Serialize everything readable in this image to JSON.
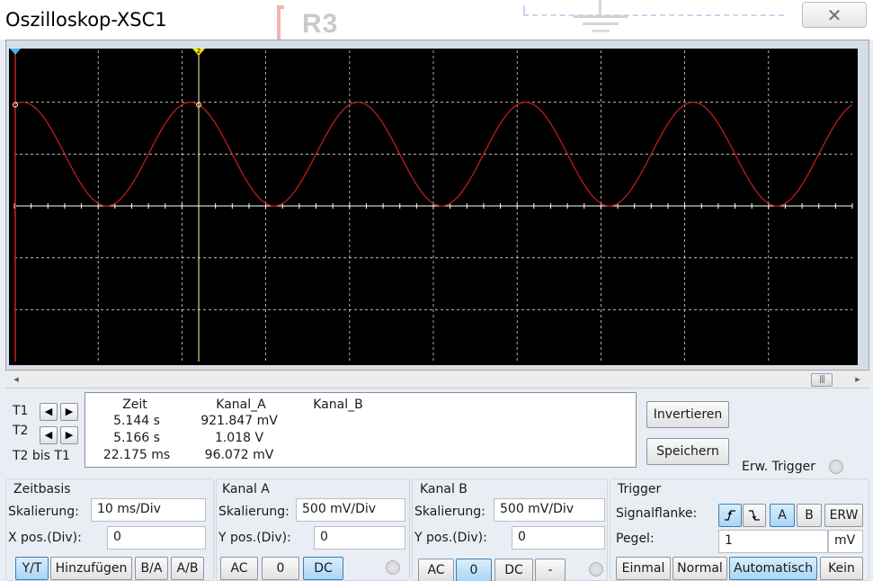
{
  "window": {
    "title": "Oszilloskop-XSC1",
    "close_icon": "close-icon"
  },
  "backdrop": {
    "component_label": "R3"
  },
  "scope": {
    "background": "#000000",
    "grid_color": "#ffffff",
    "trace_color": "#cc1f1f",
    "cursor_color": "#fff6a0",
    "divisions_x": 10,
    "divisions_y": 6,
    "cursor_marker_t2": "2",
    "t1_marker_icon": "cursor-t1-marker-icon",
    "t2_marker_icon": "cursor-t2-marker-icon"
  },
  "chart_data": {
    "type": "line",
    "series": [
      {
        "name": "Kanal_A",
        "color": "#cc1f1f",
        "waveform": "sine",
        "amplitude_div": 1.0,
        "offset_div": 1.0,
        "period_div": 2.0
      }
    ],
    "xlim_div": [
      0,
      10
    ],
    "ylim_div": [
      -3,
      3
    ]
  },
  "scrollbar": {
    "left_arrow": "◂",
    "right_arrow": "▸",
    "thumb_grip": "|||"
  },
  "cursors": {
    "t1_label": "T1",
    "t2_label": "T2",
    "diff_label": "T2 bis T1",
    "left_arrow": "◀",
    "right_arrow": "▶",
    "headers": {
      "time": "Zeit",
      "channel_a": "Kanal_A",
      "channel_b": "Kanal_B"
    },
    "rows": [
      {
        "time": "5.144 s",
        "channel_a": "921.847 mV",
        "channel_b": ""
      },
      {
        "time": "5.166 s",
        "channel_a": "1.018 V",
        "channel_b": ""
      },
      {
        "time": "22.175 ms",
        "channel_a": "96.072 mV",
        "channel_b": ""
      }
    ]
  },
  "side_buttons": {
    "invert": "Invertieren",
    "save": "Speichern",
    "ext_trigger": "Erw. Trigger"
  },
  "timebase": {
    "title": "Zeitbasis",
    "scale_label": "Skalierung:",
    "scale_value": "10 ms/Div",
    "xpos_label": "X pos.(Div):",
    "xpos_value": "0",
    "modes": [
      "Y/T",
      "Hinzufügen",
      "B/A",
      "A/B"
    ],
    "active_mode": "Y/T"
  },
  "channel_a": {
    "title": "Kanal A",
    "scale_label": "Skalierung:",
    "scale_value": "500 mV/Div",
    "ypos_label": "Y pos.(Div):",
    "ypos_value": "0",
    "coupling": [
      "AC",
      "0",
      "DC"
    ],
    "active_coupling": "DC"
  },
  "channel_b": {
    "title": "Kanal B",
    "scale_label": "Skalierung:",
    "scale_value": "500 mV/Div",
    "ypos_label": "Y pos.(Div):",
    "ypos_value": "0",
    "coupling": [
      "AC",
      "0",
      "DC",
      "-"
    ],
    "active_coupling": "0"
  },
  "trigger": {
    "title": "Trigger",
    "edge_label": "Signalflanke:",
    "edge_rising_icon": "rising-edge-icon",
    "edge_falling_icon": "falling-edge-icon",
    "source_a": "A",
    "source_b": "B",
    "source_ext": "ERW",
    "level_label": "Pegel:",
    "level_value": "1",
    "level_unit": "mV",
    "modes": [
      "Einmal",
      "Normal",
      "Automatisch",
      "Kein"
    ],
    "active_mode": "Automatisch"
  }
}
